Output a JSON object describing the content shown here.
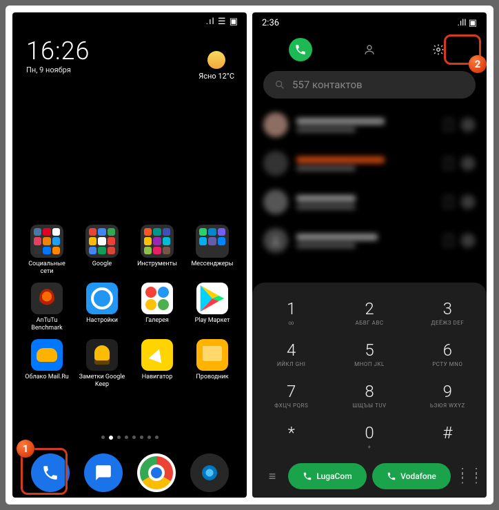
{
  "left": {
    "status_icons": ".ıl ☰ ▣",
    "clock": "16:26",
    "date": "Пн, 9 ноября",
    "weather_label": "Ясно",
    "weather_temp": "12°C",
    "folders": [
      "Социальные сети",
      "Google",
      "Инструменты",
      "Мессенджеры"
    ],
    "apps_row2": [
      "AnTuTu Benchmark",
      "Настройки",
      "Галерея",
      "Play Маркет"
    ],
    "apps_row3": [
      "Облако Mail.Ru",
      "Заметки Google Keep",
      "Навигатор",
      "Проводник"
    ]
  },
  "right": {
    "time": "2:36",
    "status_icons": ".ıll ▣",
    "search_text": "557 контактов",
    "keys": [
      {
        "n": "1",
        "l": "∞"
      },
      {
        "n": "2",
        "l": "АБВГ ABC"
      },
      {
        "n": "3",
        "l": "ДЕЁЖЗ DEF"
      },
      {
        "n": "4",
        "l": "ИЙКЛ GHI"
      },
      {
        "n": "5",
        "l": "МНОП JKL"
      },
      {
        "n": "6",
        "l": "РСТУ MNO"
      },
      {
        "n": "7",
        "l": "ФХЦЧ PQRS"
      },
      {
        "n": "8",
        "l": "ШЩЪЫ TUV"
      },
      {
        "n": "9",
        "l": "ЬЭЮЯ WXYZ"
      },
      {
        "n": "*",
        "l": ""
      },
      {
        "n": "0",
        "l": "+"
      },
      {
        "n": "#",
        "l": ""
      }
    ],
    "sim1": "LugaCom",
    "sim2": "Vodafone"
  },
  "markers": {
    "one": "1",
    "two": "2"
  }
}
